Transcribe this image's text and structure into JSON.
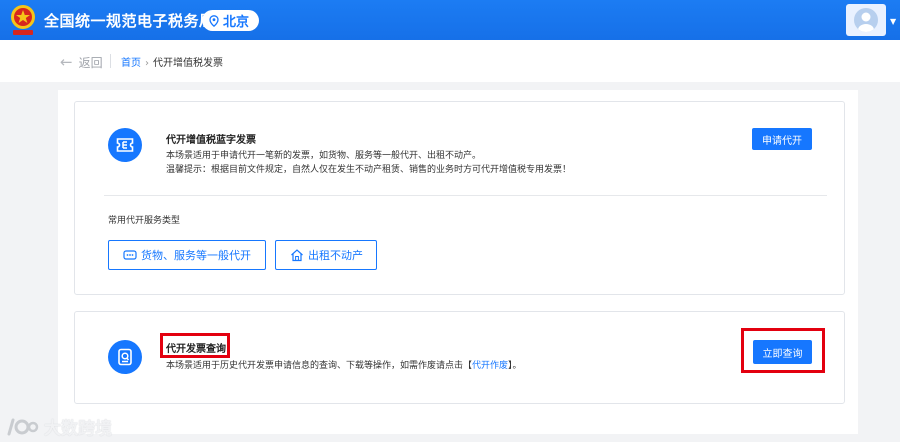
{
  "header": {
    "site_title": "全国统一规范电子税务局",
    "region": "北京"
  },
  "breadcrumb": {
    "back_label": "返回",
    "home": "首页",
    "separator": "›",
    "current": "代开增值税发票"
  },
  "blue_invoice_card": {
    "title": "代开增值税蓝字发票",
    "description": "本场景适用于申请代开一笔新的发票，如货物、服务等一般代开、出租不动产。",
    "tip": "温馨提示：根据目前文件规定，自然人仅在发生不动产租赁、销售的业务时方可代开增值税专用发票！",
    "apply_button": "申请代开",
    "section_label": "常用代开服务类型",
    "service_types": [
      {
        "label": "货物、服务等一般代开",
        "icon": "goods-service-icon"
      },
      {
        "label": "出租不动产",
        "icon": "house-icon"
      }
    ]
  },
  "query_card": {
    "title": "代开发票查询",
    "description_prefix": "本场景适用于历史代开发票申请信息的查询、下载等操作，如需作废请点击【",
    "description_link": "代开作废",
    "description_suffix": "】。",
    "query_button": "立即查询"
  },
  "watermark": "大数跨境",
  "colors": {
    "primary": "#1677ff",
    "highlight": "#e3000f"
  }
}
